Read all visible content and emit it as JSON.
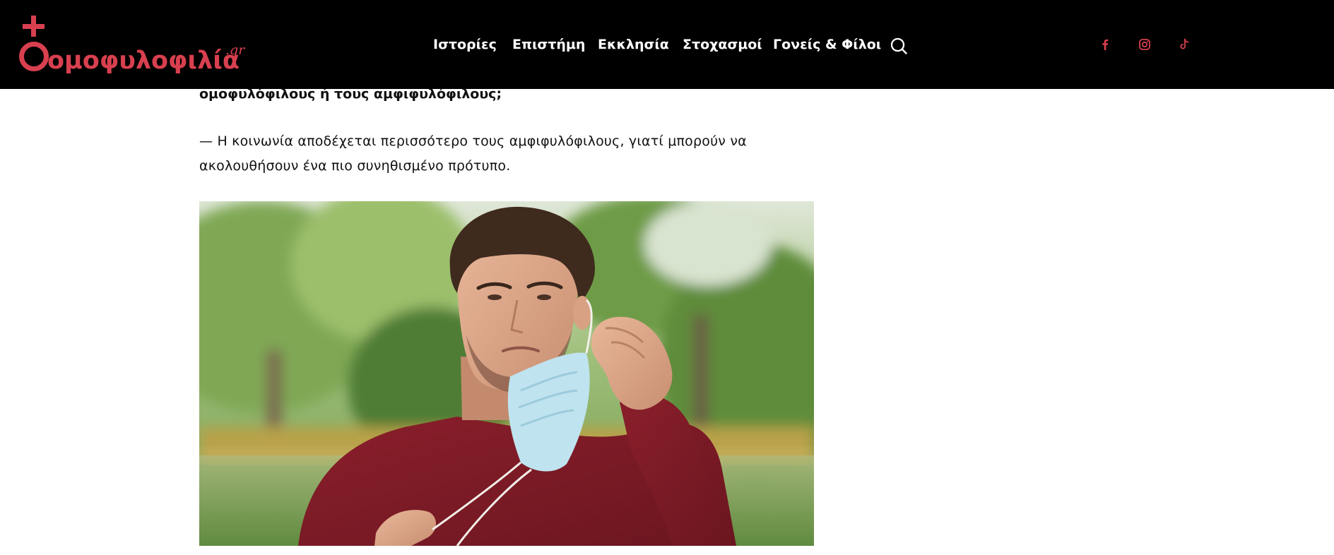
{
  "brand": {
    "logo_text": "ομοφυλοφιλία",
    "logo_suffix": ".gr",
    "accent_color": "#d8404f"
  },
  "nav": {
    "items": [
      {
        "label": "Ιστορίες"
      },
      {
        "label": "Επιστήμη"
      },
      {
        "label": "Εκκλησία"
      },
      {
        "label": "Στοχασμοί"
      },
      {
        "label": "Γονείς & Φίλοι"
      }
    ],
    "search_icon": "search-icon"
  },
  "social": [
    {
      "icon": "facebook-icon"
    },
    {
      "icon": "instagram-icon"
    },
    {
      "icon": "tiktok-icon"
    }
  ],
  "article": {
    "question_tail": "ομοφυλόφιλους ή τους αμφιφυλόφιλους;",
    "answer_line_1": "— Η κοινωνία αποδέχεται περισσότερο τους αμφιφυλόφιλους, γιατί μπορούν να",
    "answer_line_2": "ακολουθήσουν ένα πιο συνηθισμένο πρότυπο."
  }
}
